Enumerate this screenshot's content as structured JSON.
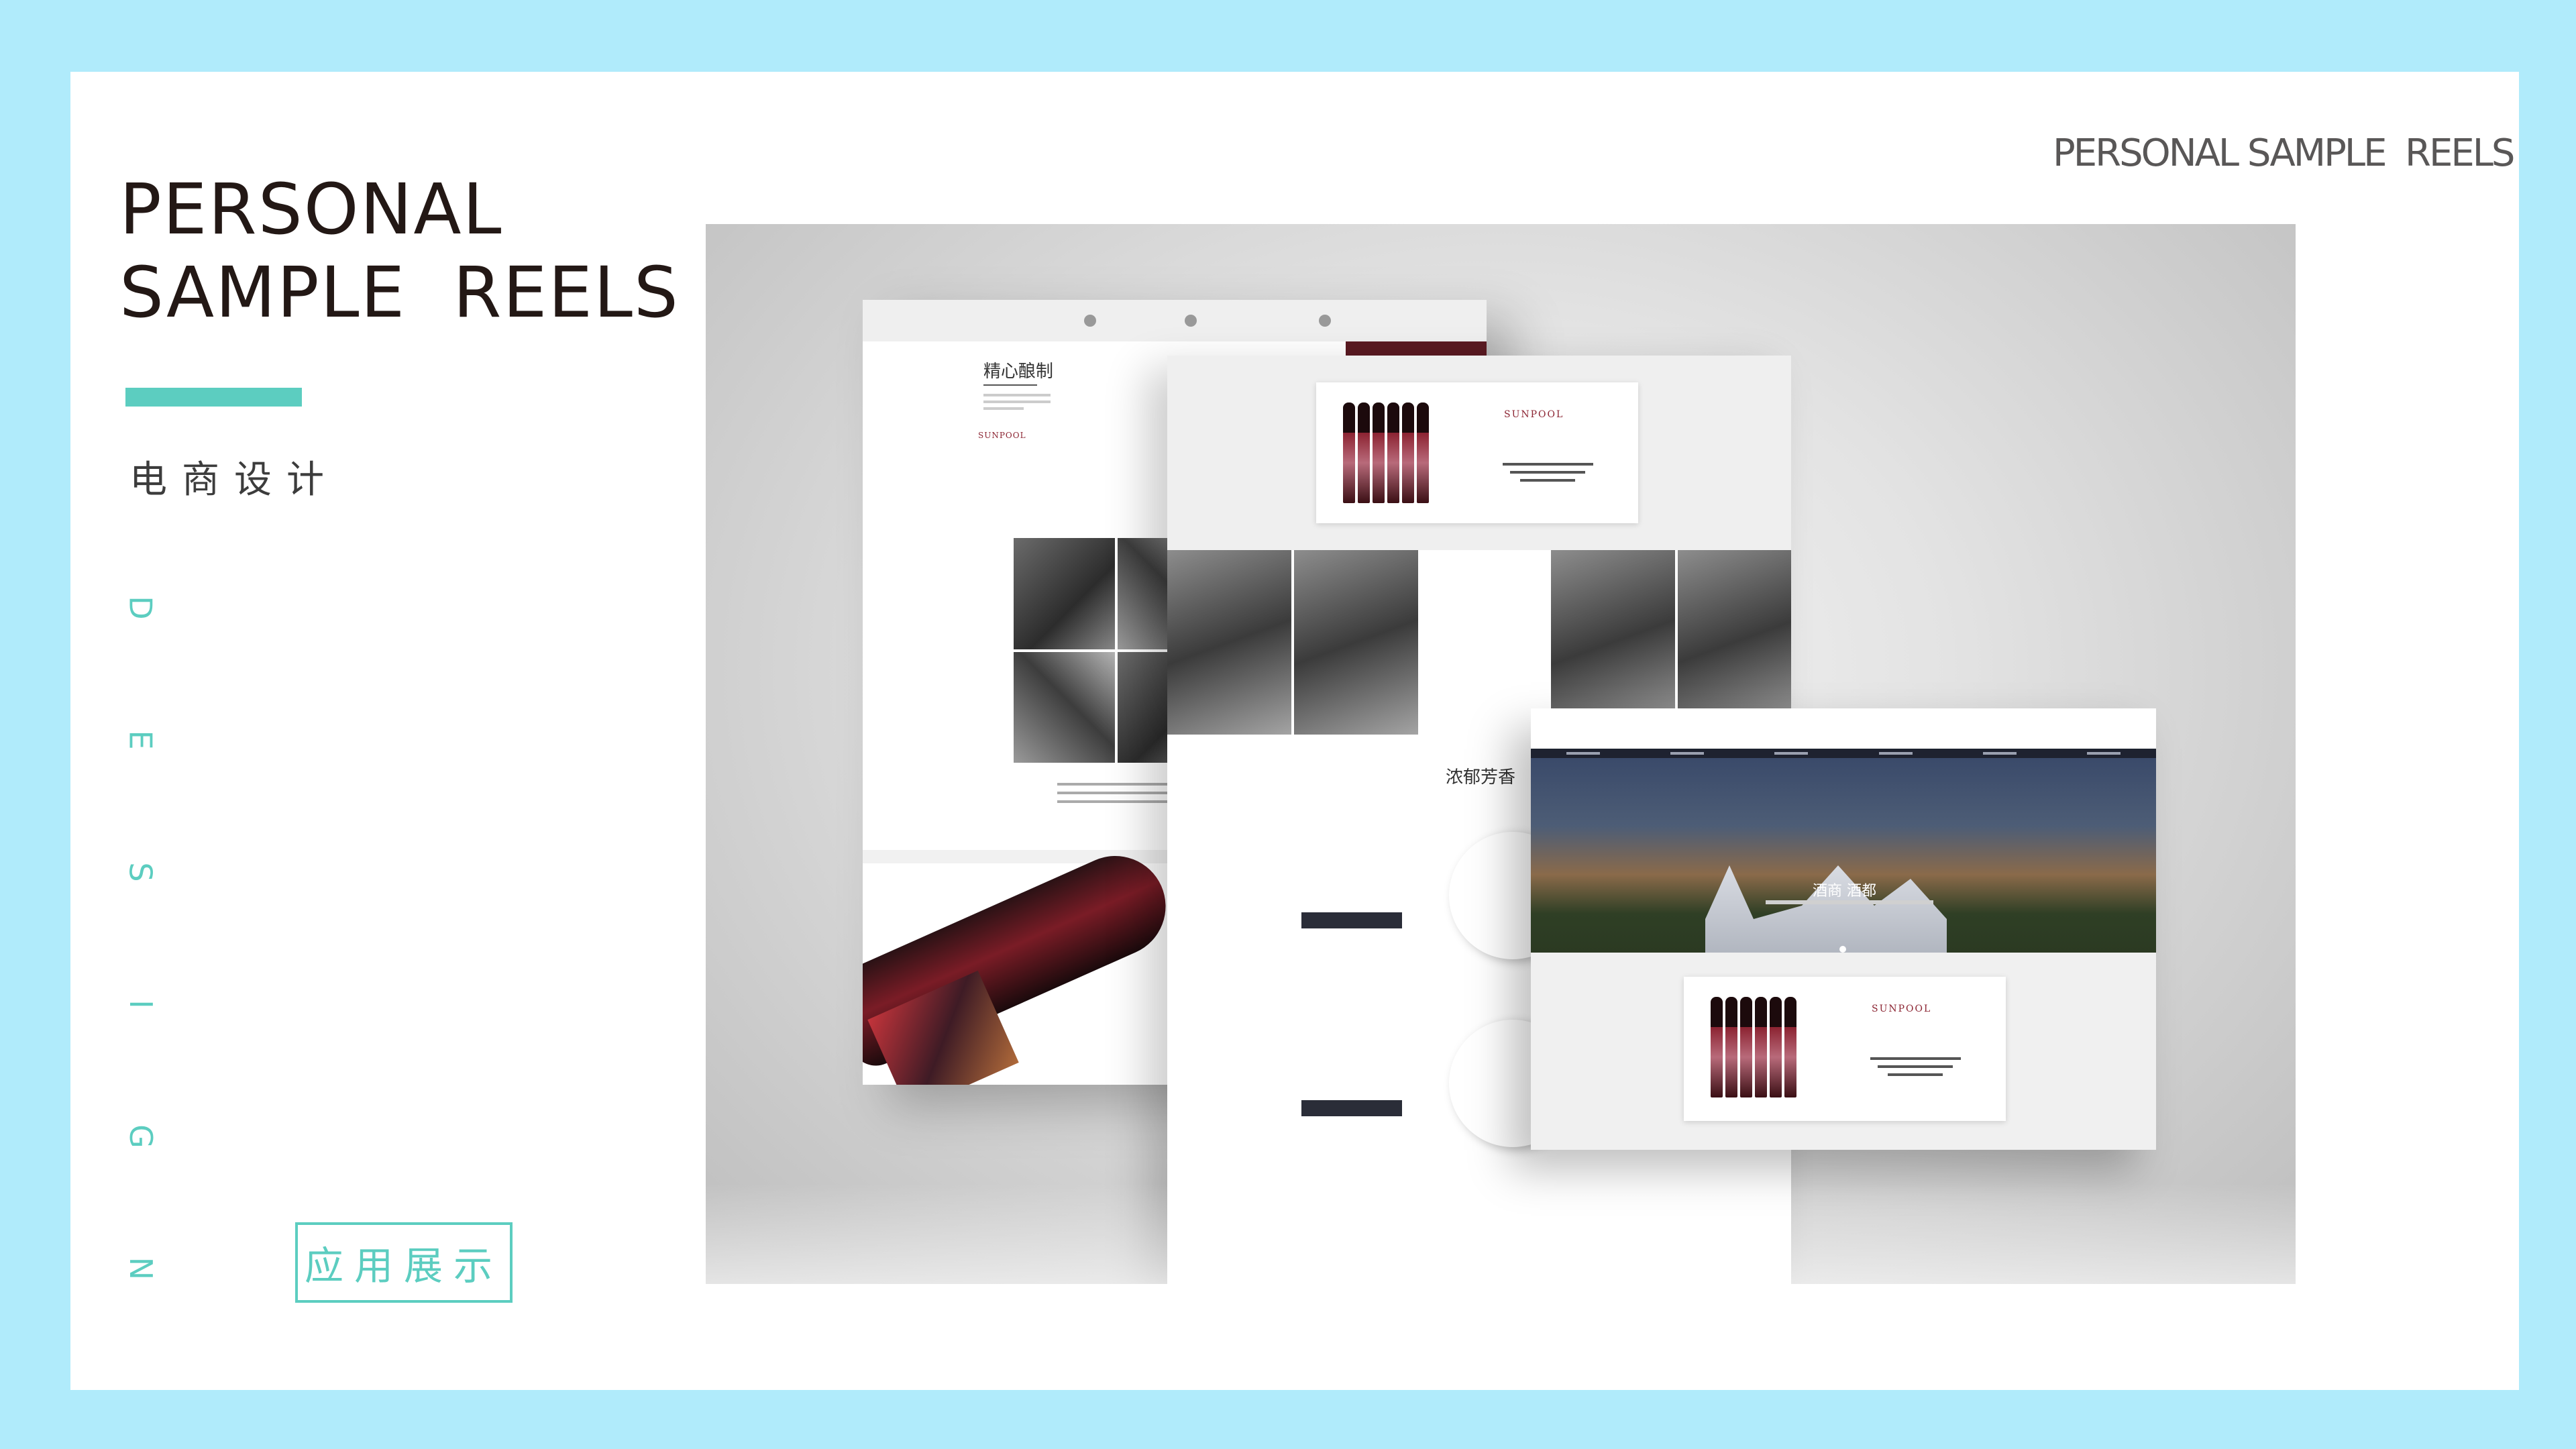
{
  "header": {
    "title_line1": "PERSONAL",
    "title_line2": "SAMPLE  REELS",
    "subtitle": "电商设计",
    "top_right": "PERSONAL SAMPLE  REELS"
  },
  "vertical_letters": [
    "D",
    "E",
    "S",
    "I",
    "G",
    "N"
  ],
  "button": {
    "label": "应用展示"
  },
  "showcase": {
    "mock1": {
      "heading": "精心酿制",
      "brand": "SUNPOOL"
    },
    "mock2": {
      "section_title": "浓郁芳香",
      "brand": "SUNPOOL"
    },
    "mock3": {
      "banner_title": "酒商 酒都",
      "brand": "SUNPOOL"
    }
  },
  "colors": {
    "frame": "#b0ebfb",
    "accent": "#5ccdc0",
    "title_text": "#231815",
    "wine_red": "#8b2331"
  }
}
